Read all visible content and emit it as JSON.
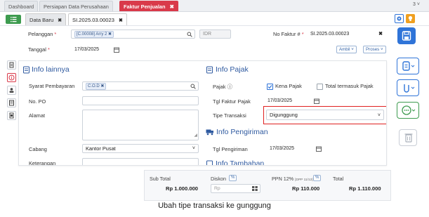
{
  "top_tabs": [
    {
      "label": "Dashboard"
    },
    {
      "label": "Persiapan Data Perusahaan"
    },
    {
      "label": "Faktur Penjualan",
      "close": "✖"
    }
  ],
  "tab_counter": "3",
  "doc_tabs": [
    {
      "label": "Data Baru",
      "close": "✖"
    },
    {
      "label": "SI.2025.03.00023",
      "close": "✖"
    }
  ],
  "header": {
    "pelanggan_label": "Pelanggan",
    "required_mark": "*",
    "pelanggan_value": "[C.00008] Arry 2",
    "tag_close": "✖",
    "currency": "IDR",
    "no_faktur_label": "No Faktur #",
    "no_faktur_value": "SI.2025.03.00023",
    "tanggal_label": "Tanggal",
    "tanggal_value": "17/03/2025",
    "ambil_label": "Ambil",
    "proses_label": "Proses"
  },
  "info_lainnya": {
    "title": "Info lainnya",
    "syarat_label": "Syarat Pembayaran",
    "syarat_value": "C.O.D",
    "no_po_label": "No. PO",
    "no_po_value": "",
    "alamat_label": "Alamat",
    "alamat_value": "",
    "cabang_label": "Cabang",
    "cabang_value": "Kantor Pusat",
    "keterangan_label": "Keterangan"
  },
  "info_pajak": {
    "title": "Info Pajak",
    "pajak_label": "Pajak",
    "kena_pajak_label": "Kena Pajak",
    "termasuk_pajak_label": "Total termasuk Pajak",
    "tgl_faktur_pajak_label": "Tgl Faktur Pajak",
    "tgl_faktur_pajak_value": "17/03/2025",
    "tipe_transaksi_label": "Tipe Transaksi",
    "tipe_transaksi_value": "Digunggung"
  },
  "info_pengiriman": {
    "title": "Info Pengiriman",
    "tgl_pengiriman_label": "Tgl Pengiriman",
    "tgl_pengiriman_value": "17/03/2025",
    "next_title": "Info Tambahan"
  },
  "totals": {
    "sub_total_label": "Sub Total",
    "sub_total_value": "Rp 1.000.000",
    "diskon_label": "Diskon",
    "diskon_placeholder": "Rp",
    "ppn_label": "PPN 12%",
    "ppn_note": "[DPP 11/12]",
    "ppn_value": "Rp 110.000",
    "total_label": "Total",
    "total_value": "Rp 1.110.000"
  },
  "caption": "Ubah tipe transaksi ke gunggung",
  "colors": {
    "active_tab": "#d93a4a",
    "primary_blue": "#2f74d8",
    "heading_blue": "#2f5aa0",
    "green": "#3d9b4f",
    "highlight_red": "#e02020",
    "orange": "#f0a020"
  },
  "icons": [
    "list-icon",
    "gear-icon",
    "lightbulb-icon",
    "save-icon",
    "search-icon",
    "calendar-icon",
    "chevron-down-icon",
    "document-icon",
    "info-icon",
    "user-icon",
    "notes-icon",
    "printer-icon",
    "paperclip-icon",
    "more-icon",
    "trash-icon",
    "truck-icon",
    "checkmark-icon",
    "grid-icon"
  ]
}
